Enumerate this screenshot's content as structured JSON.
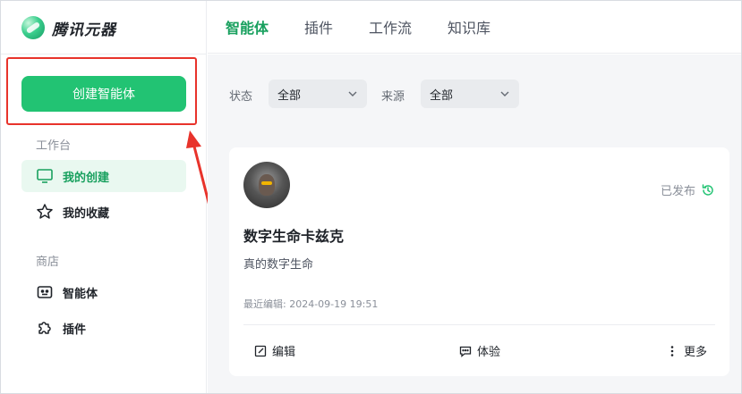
{
  "brand": {
    "name": "腾讯元器"
  },
  "sidebar": {
    "create_label": "创建智能体",
    "workspace_title": "工作台",
    "my_created": "我的创建",
    "my_favorites": "我的收藏",
    "store_title": "商店",
    "agents": "智能体",
    "plugins": "插件"
  },
  "topbar": {
    "tabs": [
      "智能体",
      "插件",
      "工作流",
      "知识库"
    ]
  },
  "filters": {
    "status_label": "状态",
    "status_value": "全部",
    "source_label": "来源",
    "source_value": "全部"
  },
  "card": {
    "status": "已发布",
    "title": "数字生命卡兹克",
    "description": "真的数字生命",
    "last_edited": "最近编辑: 2024-09-19 19:51",
    "edit_label": "编辑",
    "try_label": "体验",
    "more_label": "更多"
  },
  "colors": {
    "accent": "#22c373",
    "accent_text": "#18a05e",
    "annotation_red": "#e8332b"
  }
}
